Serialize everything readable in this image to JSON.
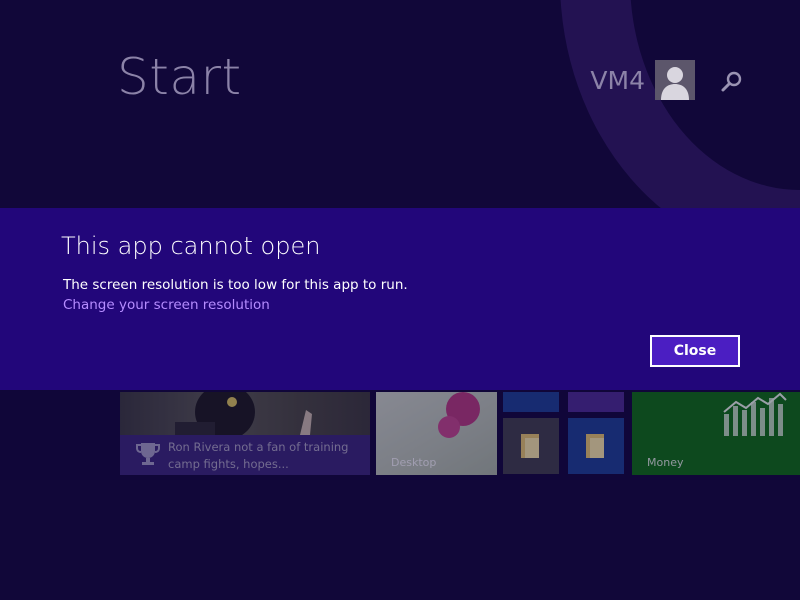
{
  "start": {
    "title": "Start",
    "user_name": "VM4"
  },
  "icons": {
    "avatar": "user-avatar-icon",
    "search": "search-icon",
    "trophy": "trophy-icon",
    "folder": "folder-icon",
    "money_chart": "bar-chart-icon"
  },
  "tiles": {
    "news": {
      "text": "Ron Rivera not a fan of training camp fights, hopes..."
    },
    "desktop": {
      "label": "Desktop"
    },
    "money": {
      "label": "Money"
    }
  },
  "dialog": {
    "title": "This app cannot open",
    "message": "The screen resolution is too low for this app to run.",
    "link": "Change your screen resolution",
    "close_label": "Close"
  },
  "colors": {
    "background": "#110739",
    "dialog_band": "#22067a",
    "close_button": "#4b1ec2",
    "link": "#b58cff",
    "money_tile": "#0d6d10"
  }
}
